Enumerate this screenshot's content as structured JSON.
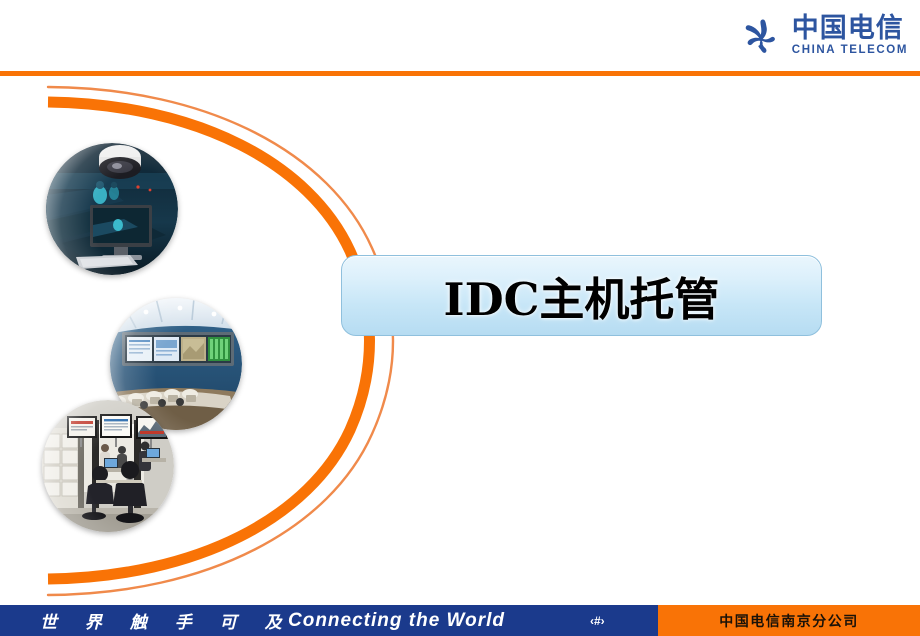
{
  "slide": {
    "title": "IDC主机托管",
    "background_color": "#ffffff"
  },
  "branding": {
    "logo_name_cn": "中国电信",
    "logo_name_en": "CHINA TELECOM",
    "logo_color": "#2d55a0",
    "logo_icon": "china-telecom-mark"
  },
  "accents": {
    "orange": "#f97306",
    "orange_light": "#f08a4b",
    "navy": "#1b3a8c",
    "title_plate_border": "#8fc0dd"
  },
  "decor": {
    "arcs": [
      {
        "name": "outer-thin-arc",
        "color": "#f08a4b",
        "width": 2
      },
      {
        "name": "inner-thick-arc",
        "color": "#f97306",
        "width": 11
      }
    ]
  },
  "photos": [
    {
      "name": "surveillance-camera-monitoring",
      "caption": "Surveillance camera and monitoring workstation"
    },
    {
      "name": "network-operations-center",
      "caption": "Network operations center with large display wall"
    },
    {
      "name": "data-center-operations-room",
      "caption": "Data center operations room with staff and racks"
    }
  ],
  "footer": {
    "tagline_cn": "世 界 触 手 可 及",
    "tagline_en": "Connecting  the   World",
    "slide_number": "‹#›",
    "company": "中国电信南京分公司",
    "left_bg": "#1b3a8c",
    "right_bg": "#f97306"
  }
}
